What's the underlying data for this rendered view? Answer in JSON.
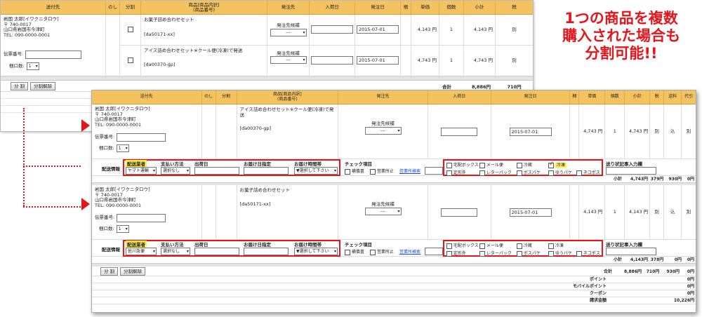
{
  "headline": [
    "1つの商品を複数",
    "購入された場合も",
    "分割可能!!"
  ],
  "colors": {
    "header": "#f4c25e",
    "accent": "#e8141b",
    "highlight": "#ffec4a"
  },
  "top": {
    "headers": [
      "送付先",
      "のし",
      "分割",
      "商品[商品内訳]\n(商品番号)",
      "発注先",
      "入荷日",
      "発注日",
      "梱",
      "単価",
      "個数",
      "小計",
      "税"
    ],
    "address": [
      "岩国 太郎[イワクニタロウ]",
      "〒 740-0017",
      "山口県岩国市今津町",
      "TEL: 090-0000-0001"
    ],
    "tracking_label": "伝票番号:",
    "package_label": "梱口数:",
    "package_value": "1",
    "items": [
      {
        "name": "お菓子詰め合わせセット",
        "code": "[da50171-xx]",
        "supplier": "発注先候補",
        "supplier_select": "---",
        "order_date": "2015-07-01",
        "price": "4,143 円",
        "qty": "1",
        "subtotal": "4,143 円",
        "tax": "別"
      },
      {
        "name": "アイス詰め合わせセット※クール便(冷凍)で発送",
        "code": "[da00370-gp]",
        "supplier": "発注先候補",
        "supplier_select": "---",
        "order_date": "2015-07-01",
        "price": "4,743 円",
        "qty": "1",
        "subtotal": "4,743 円",
        "tax": "別"
      }
    ],
    "split_btn": "分 割",
    "unsplit_btn": "分割解除",
    "total_label": "合計",
    "total_value": "8,886円",
    "tax_value": "710円"
  },
  "bottom": {
    "headers": [
      "送付先",
      "のし",
      "分割",
      "商品[商品内訳]\n(商品番号)",
      "発注先",
      "入荷日",
      "発注日",
      "梱",
      "単価",
      "個数",
      "小計",
      "税",
      "送料",
      "代引"
    ],
    "address": [
      "岩国 太郎[イワクニタロウ]",
      "〒 740-0017",
      "山口県岩国市今津町",
      "TEL: 090-0000-0001"
    ],
    "tracking_label": "伝票番号:",
    "package_label": "梱口数:",
    "package_value": "1",
    "shipping_label": "配送情報",
    "carrier_label": "配送業者",
    "payment_label": "支払い方法",
    "ship_date_label": "出荷日",
    "delivery_date_label": "お届け日指定",
    "delivery_time_label": "お届け時間帯",
    "check_label": "チェック項目",
    "check_items": [
      "補償書",
      "営業所止"
    ],
    "office_link": "営業所検索",
    "box_options": [
      [
        "宅配ボックス",
        "メール便",
        "冷蔵",
        "冷凍"
      ],
      [
        "定形外",
        "レターパック",
        "ポスパケ",
        "ゆうパケ",
        "ネコポス"
      ]
    ],
    "tracking_input_label": "送り状記事入力欄",
    "payment_value": "選択なし",
    "time_value": "▼選択して下さい",
    "groups": [
      {
        "item_name": "アイス詰め合わせセット※クール便(冷凍)で発送",
        "code": "[da00370-gp]",
        "supplier": "発注先候補",
        "supplier_select": "---",
        "order_date": "2015-07-01",
        "price": "4,743 円",
        "qty": "1",
        "subtotal": "4,743 円",
        "tax": "別",
        "shipping": "込",
        "cod": "別",
        "carrier": "ヤマト運輸",
        "frozen_checked": true,
        "sub_label": "小計",
        "sub_total": "4,743円",
        "sub_tax": "379円",
        "sub_ship": "930円",
        "sub_cod": "0円"
      },
      {
        "item_name": "お菓子詰め合わせセット",
        "code": "[da50171-xx]",
        "supplier": "発注先候補",
        "supplier_select": "---",
        "order_date": "2015-07-01",
        "price": "4,143 円",
        "qty": "1",
        "subtotal": "4,143 円",
        "tax": "別",
        "shipping": "込",
        "cod": "別",
        "carrier": "佐川急便",
        "frozen_checked": false,
        "sub_label": "小計",
        "sub_total": "4,143円",
        "sub_tax": "378円",
        "sub_ship": "0円",
        "sub_cod": "0円"
      }
    ],
    "split_btn": "分 割",
    "unsplit_btn": "分割解除",
    "totals": [
      {
        "label": "合計",
        "v1": "8,886円",
        "v2": "710円",
        "v3": "930円",
        "v4": "0円"
      },
      {
        "label": "ポイント",
        "v4": "0円"
      },
      {
        "label": "モバイルポイント",
        "v4": "0円"
      },
      {
        "label": "クーポン",
        "v4": "0円"
      },
      {
        "label": "請求金額",
        "v4": "10,226円"
      }
    ]
  }
}
